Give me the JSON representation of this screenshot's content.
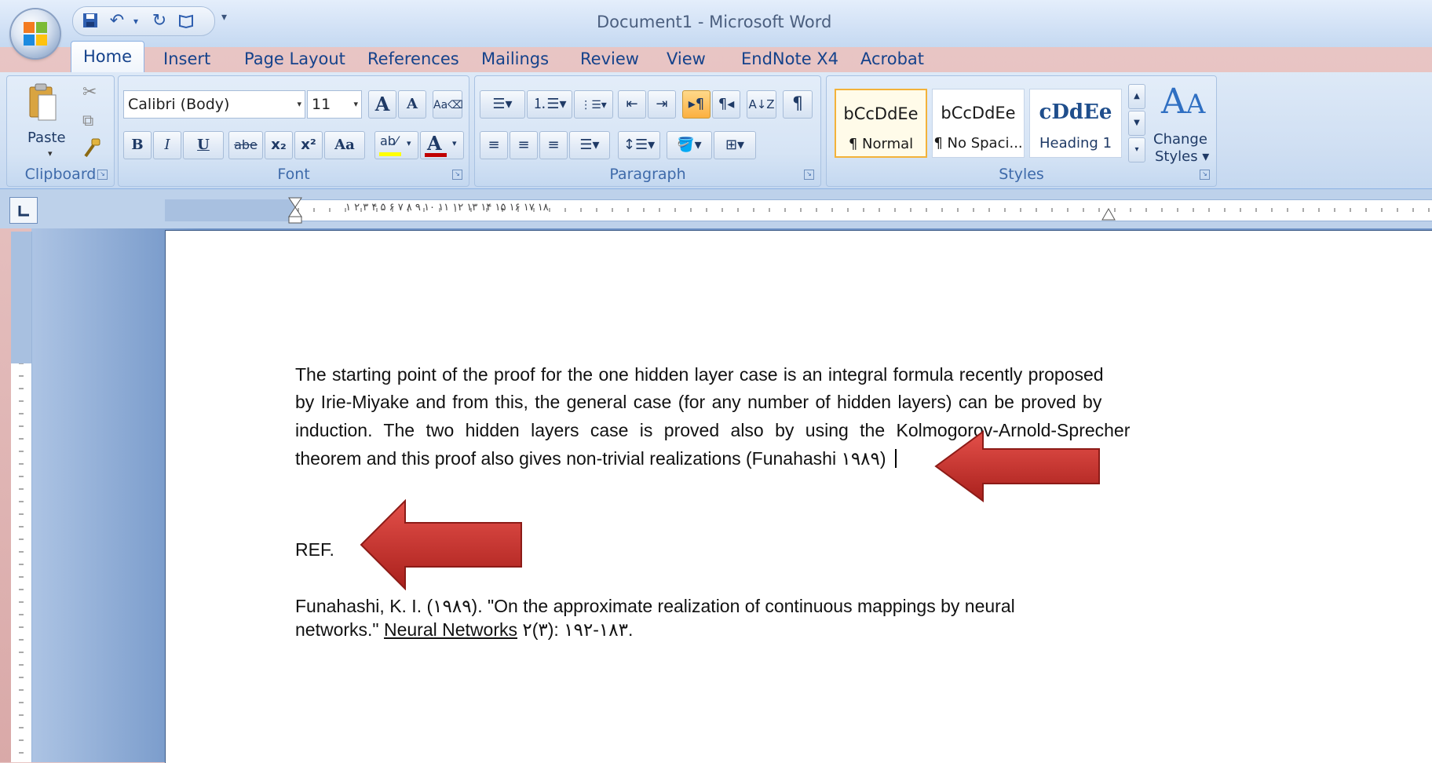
{
  "window": {
    "title": "Document1 - Microsoft Word"
  },
  "quick_access": {
    "more": "▾"
  },
  "tabs": [
    "Home",
    "Insert",
    "Page Layout",
    "References",
    "Mailings",
    "Review",
    "View",
    "EndNote X4",
    "Acrobat"
  ],
  "clipboard": {
    "paste_label": "Paste",
    "group_label": "Clipboard"
  },
  "font": {
    "name": "Calibri (Body)",
    "size": "11",
    "group_label": "Font",
    "bold": "B",
    "italic": "I",
    "underline": "U",
    "strike": "abe",
    "subscript": "x₂",
    "superscript": "x²",
    "change_case": "Aa",
    "grow": "A",
    "shrink": "A",
    "highlight_color": "#ffff00",
    "font_color": "#c00000"
  },
  "paragraph": {
    "group_label": "Paragraph"
  },
  "styles": {
    "group_label": "Styles",
    "items": [
      {
        "sample": "bCcDdEe",
        "name": "¶ Normal"
      },
      {
        "sample": "bCcDdEe",
        "name": "¶ No Spaci..."
      },
      {
        "sample": "cDdEe",
        "name": "Heading 1"
      }
    ],
    "change_label_1": "Change",
    "change_label_2": "Styles ▾"
  },
  "ruler": {
    "numbers": "۱ ۲ ۳ ۴ ۵ ۶ ۷ ۸ ۹ ۱۰ ۱۱ ۱۲ ۱۳ ۱۴ ۱۵ ۱۶ ۱۷ ۱۸"
  },
  "document": {
    "paragraph_lines": [
      "The starting point of the proof for the one hidden layer case is an integral formula recently proposed",
      "by Irie-Miyake and from this, the general case (for any number of hidden layers) can be proved by",
      "induction. The two hidden layers case is proved also by using the Kolmogorov-Arnold-Sprecher",
      "theorem and this proof also gives non-trivial realizations (Funahashi ۱۹۸۹)"
    ],
    "ref_heading": "REF.",
    "ref_line_1": "Funahashi, K. I. (۱۹۸۹). \"On the approximate realization of continuous mappings by neural",
    "ref_line_2_prefix": "networks.\" ",
    "ref_line_2_journal": "Neural Networks",
    "ref_line_2_suffix": " ۲(۳): ۱۹۲-۱۸۳."
  }
}
